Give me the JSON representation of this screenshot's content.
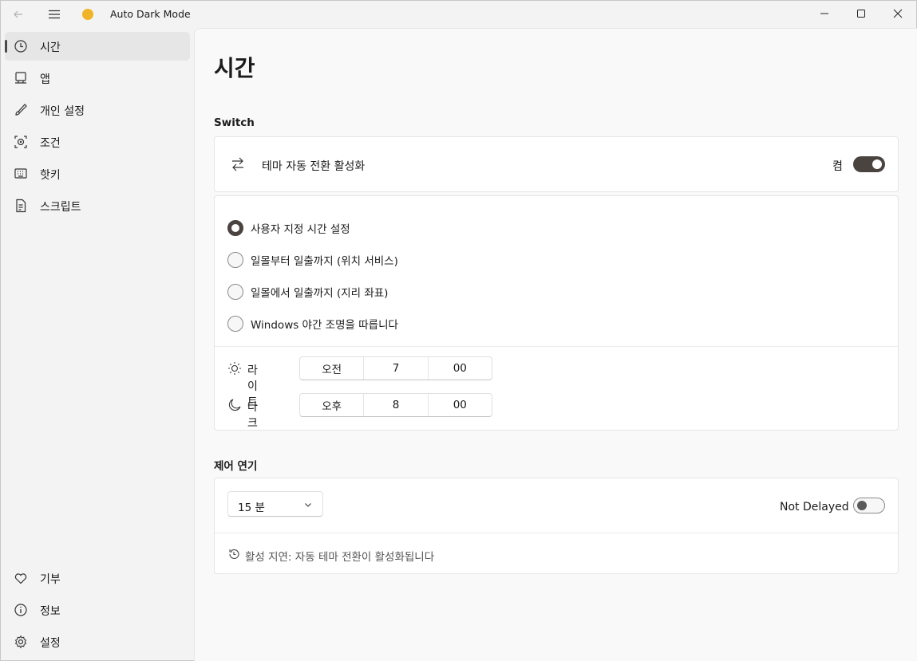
{
  "window": {
    "title": "Auto Dark Mode"
  },
  "sidebar": {
    "items": [
      {
        "label": "시간",
        "icon": "clock-icon"
      },
      {
        "label": "앱",
        "icon": "monitor-icon"
      },
      {
        "label": "개인 설정",
        "icon": "brush-icon"
      },
      {
        "label": "조건",
        "icon": "conditions-icon"
      },
      {
        "label": "핫키",
        "icon": "keyboard-icon"
      },
      {
        "label": "스크립트",
        "icon": "script-icon"
      }
    ],
    "footer": [
      {
        "label": "기부",
        "icon": "heart-icon"
      },
      {
        "label": "정보",
        "icon": "info-icon"
      },
      {
        "label": "설정",
        "icon": "gear-icon"
      }
    ]
  },
  "page": {
    "title": "시간",
    "switch_section": {
      "title": "Switch",
      "toggle_label": "테마 자동 전환 활성화",
      "toggle_state": "켬"
    },
    "modes": [
      {
        "label": "사용자 지정 시간 설정",
        "checked": true
      },
      {
        "label": "일몰부터 일출까지 (위치 서비스)",
        "checked": false
      },
      {
        "label": "일몰에서 일출까지 (지리 좌표)",
        "checked": false
      },
      {
        "label": "Windows 야간 조명을 따릅니다",
        "checked": false
      }
    ],
    "times": {
      "light": {
        "label": "라이트",
        "ampm": "오전",
        "hour": "7",
        "minute": "00"
      },
      "dark": {
        "label": "다크",
        "ampm": "오후",
        "hour": "8",
        "minute": "00"
      }
    },
    "delay_section": {
      "title": "제어 연기",
      "combo_value": "15 분",
      "status_label": "Not Delayed",
      "info": "활성 지연: 자동 테마 전환이 활성화됩니다"
    }
  },
  "colors": {
    "accent": "#4a4340",
    "content_bg": "#f9f9f9",
    "sidebar_bg": "#f3f3f3"
  }
}
